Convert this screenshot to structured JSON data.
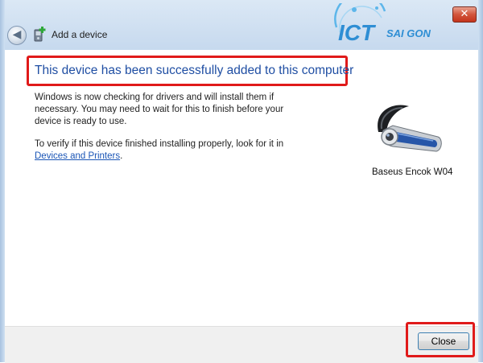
{
  "window": {
    "close_glyph": "✕",
    "back_glyph": "◀",
    "title": "Add a device"
  },
  "watermark": {
    "brand_main": "ICT",
    "brand_sub": "SAI GON"
  },
  "main": {
    "heading": "This device has been successfully added to this computer",
    "paragraph1": "Windows is now checking for drivers and will install them if necessary. You may need to wait for this to finish before your device is ready to use.",
    "paragraph2_prefix": "To verify if this device finished installing properly, look for it in",
    "paragraph2_link": "Devices and Printers",
    "paragraph2_suffix": "."
  },
  "device": {
    "name": "Baseus Encok W04",
    "icon": "bluetooth-headset-icon"
  },
  "footer": {
    "close_label": "Close"
  },
  "colors": {
    "heading": "#1f4ea3",
    "link": "#1a55b6",
    "highlight": "#e01a1a"
  }
}
